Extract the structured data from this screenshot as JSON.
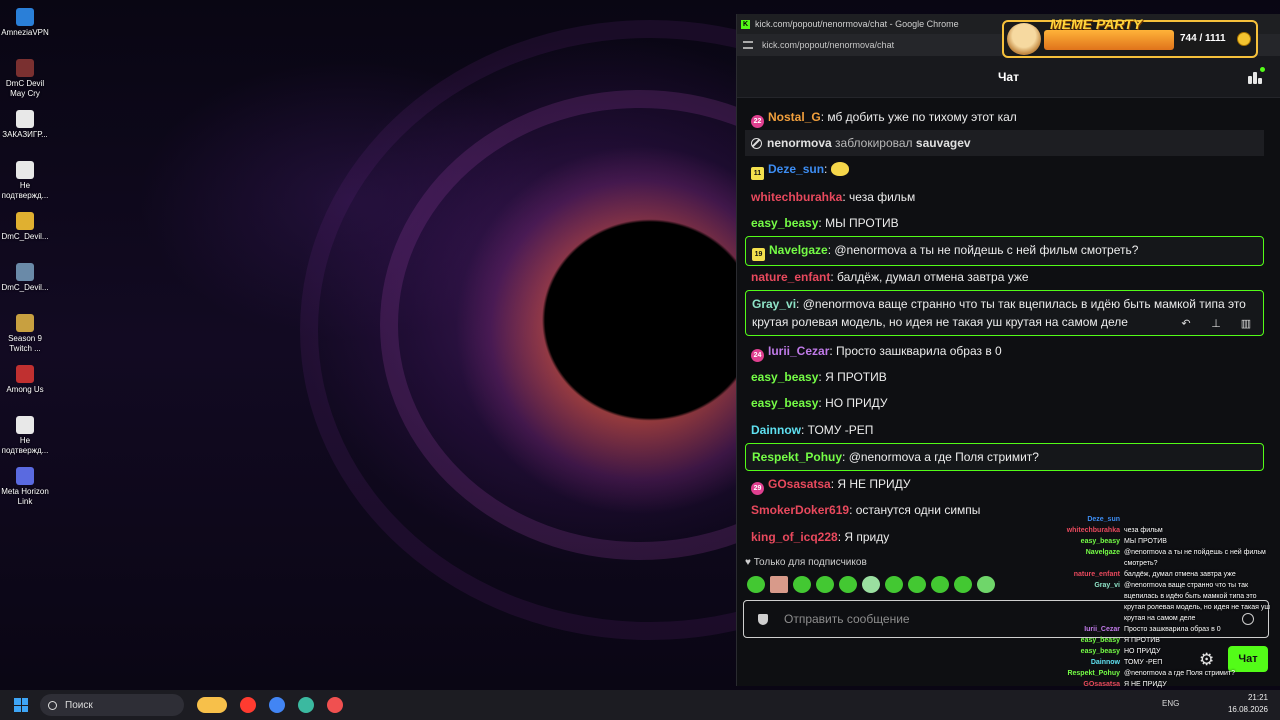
{
  "desktop": {
    "icons": [
      {
        "label": "AmneziaVPN",
        "color": "#2a7fd8"
      },
      {
        "label": "DmC Devil May Cry",
        "color": "#7a3030"
      },
      {
        "label": "ЗАКАЗИГР...",
        "color": "#e8e8e8"
      },
      {
        "label": "Не подтвержд...",
        "color": "#e8e8e8"
      },
      {
        "label": "DmC_Devil...",
        "color": "#e0b030"
      },
      {
        "label": "DmC_Devil...",
        "color": "#6a8aa8"
      },
      {
        "label": "Season 9 Twitch ...",
        "color": "#c8a040"
      },
      {
        "label": "Among Us",
        "color": "#c03030"
      },
      {
        "label": "Не подтвержд...",
        "color": "#e8e8e8"
      },
      {
        "label": "Meta Horizon Link",
        "color": "#5a6ae0"
      }
    ]
  },
  "browser": {
    "window_title": "kick.com/popout/nenormova/chat - Google Chrome",
    "url": "kick.com/popout/nenormova/chat"
  },
  "chat": {
    "header_title": "Чат",
    "messages": [
      {
        "badge": "22",
        "badge_color": "#e04090",
        "user": "Nostal_G",
        "user_color": "#f2a03d",
        "text": ": мб добить уже по тихому этот кал"
      },
      {
        "type": "system",
        "user": "nenormova",
        "text": " заблокировал ",
        "target": "sauvagev"
      },
      {
        "badge": "11",
        "badge_color": "#f4e04d",
        "user": "Deze_sun",
        "user_color": "#3d8df2",
        "text": ":",
        "emote": true
      },
      {
        "user": "whitechburahka",
        "user_color": "#e8495d",
        "text": ": чеза фильм"
      },
      {
        "user": "easy_beasy",
        "user_color": "#75fd46",
        "text": ": МЫ ПРОТИВ"
      },
      {
        "badge": "19",
        "badge_color": "#f4e04d",
        "user": "Navelgaze",
        "user_color": "#75fd46",
        "text": ": @nenormova а ты не пойдешь с ней фильм смотреть?",
        "highlight": true
      },
      {
        "user": "nature_enfant",
        "user_color": "#e8495d",
        "text": ": балдёж, думал отмена завтра уже"
      },
      {
        "user": "Gray_vi",
        "user_color": "#8ee3c7",
        "text": ": @nenormova ваще странно что ты так вцепилась в идёю быть мамкой типа это крутая ролевая модель, но идея не такая уш крутая на самом деле",
        "highlight": true
      },
      {
        "badge": "24",
        "badge_color": "#e04090",
        "user": "Iurii_Cezar",
        "user_color": "#c07ae8",
        "text": ": Просто зашкварила образ в 0"
      },
      {
        "user": "easy_beasy",
        "user_color": "#75fd46",
        "text": ": Я ПРОТИВ"
      },
      {
        "user": "easy_beasy",
        "user_color": "#75fd46",
        "text": ": НО ПРИДУ"
      },
      {
        "user": "Dainnow",
        "user_color": "#5fe0f0",
        "text": ": ТОМУ -РЕП"
      },
      {
        "user": "Respekt_Pohuy",
        "user_color": "#75fd46",
        "text": ": @nenormova а где Поля стримит?",
        "highlight": true
      },
      {
        "badge": "29",
        "badge_color": "#e04090",
        "user": "GOsasatsa",
        "user_color": "#e8495d",
        "text": ": Я НЕ ПРИДУ"
      },
      {
        "user": "SmokerDoker619",
        "user_color": "#e8495d",
        "text": ": останутся одни симпы"
      },
      {
        "user": "king_of_icq228",
        "user_color": "#e8495d",
        "text": ": Я приду"
      }
    ],
    "actions": {
      "reply_icon": "reply-icon",
      "pin_icon": "pin-icon",
      "delete_icon": "trash-icon"
    },
    "subscribers_only": "♥ Только для подписчиков",
    "input_placeholder": "Отправить сообщение",
    "send_label": "Чат",
    "accent": "#53fc18"
  },
  "meme_widget": {
    "title": "MEME PARTY",
    "count": "744 / 1111"
  },
  "overlay_chat": [
    {
      "user": "Deze_sun",
      "color": "#3d8df2",
      "text": ""
    },
    {
      "user": "whitechburahka",
      "color": "#e8495d",
      "text": "чеза фильм"
    },
    {
      "user": "easy_beasy",
      "color": "#75fd46",
      "text": "МЫ ПРОТИВ"
    },
    {
      "user": "Navelgaze",
      "color": "#75fd46",
      "text": "@nenormova а ты не пойдешь с ней фильм смотреть?"
    },
    {
      "user": "nature_enfant",
      "color": "#e8495d",
      "text": "балдёж, думал отмена завтра уже"
    },
    {
      "user": "Gray_vi",
      "color": "#8ee3c7",
      "text": "@nenormova ваще странно что ты так вцепилась в идёю быть мамкой типа это крутая ролевая модель, но идея не такая уш крутая на самом деле"
    },
    {
      "user": "Iurii_Cezar",
      "color": "#c07ae8",
      "text": "Просто зашкварила образ в 0"
    },
    {
      "user": "easy_beasy",
      "color": "#75fd46",
      "text": "Я ПРОТИВ"
    },
    {
      "user": "easy_beasy",
      "color": "#75fd46",
      "text": "НО ПРИДУ"
    },
    {
      "user": "Dainnow",
      "color": "#5fe0f0",
      "text": "ТОМУ -РЕП"
    },
    {
      "user": "Respekt_Pohuy",
      "color": "#75fd46",
      "text": "@nenormova а где Поля стримит?"
    },
    {
      "user": "GOsasatsa",
      "color": "#e8495d",
      "text": "Я НЕ ПРИДУ"
    },
    {
      "user": "SmokerDoker619",
      "color": "#e8495d",
      "text": "останутся одни симпы"
    }
  ],
  "taskbar": {
    "search_label": "Поиск",
    "language": "ENG",
    "time": "21:21",
    "date": "16.08.2026",
    "apps": [
      "#f7c04a",
      "#ff3b30",
      "#4285f4",
      "#3bb9a0",
      "#f05050"
    ]
  }
}
